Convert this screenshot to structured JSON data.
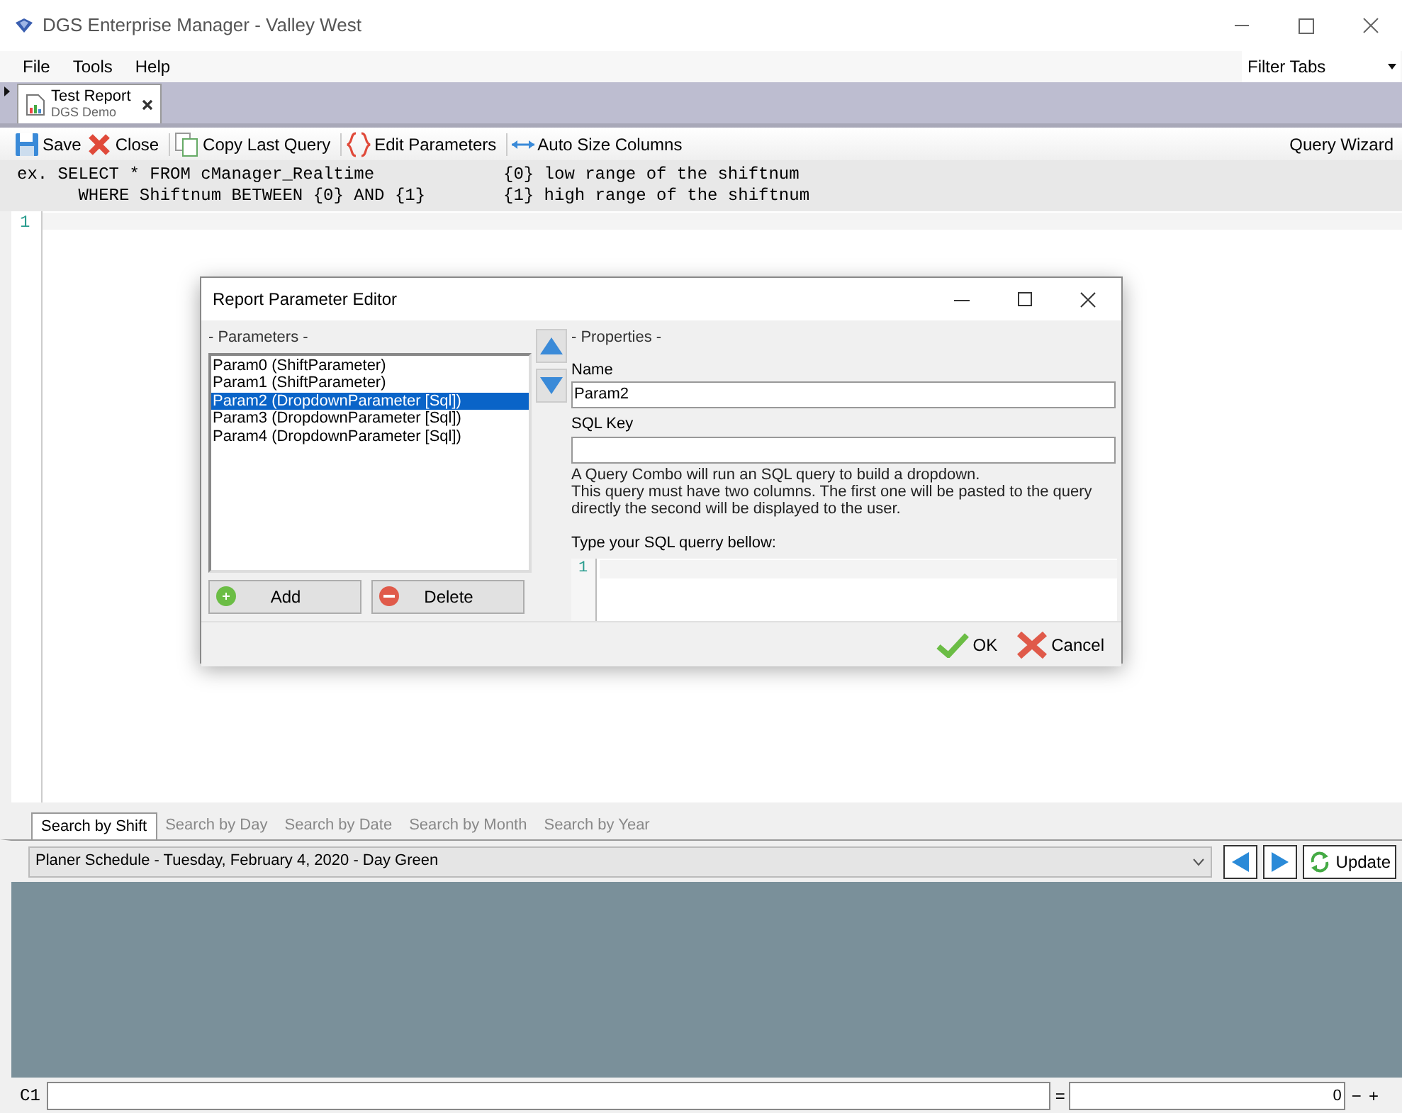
{
  "window": {
    "title": "DGS Enterprise Manager - Valley West"
  },
  "menu": [
    {
      "label": "File"
    },
    {
      "label": "Tools"
    },
    {
      "label": "Help"
    }
  ],
  "filter_tabs": {
    "value": "Filter Tabs"
  },
  "doc_tabs": [
    {
      "title": "Test Report",
      "subtitle": "DGS Demo",
      "selected": true
    }
  ],
  "toolbar": [
    {
      "kind": "save",
      "label": "Save"
    },
    {
      "kind": "close",
      "label": "Close"
    },
    {
      "kind": "copy",
      "label": "Copy Last Query"
    },
    {
      "kind": "params",
      "label": "Edit Parameters"
    },
    {
      "kind": "autosize",
      "label": "Auto Size Columns"
    }
  ],
  "query_wizard": "Query Wizard",
  "sql_hint": [
    {
      "code": "ex. SELECT * FROM cManager_Realtime",
      "note": "{0} low range of the shiftnum"
    },
    {
      "code": "      WHERE Shiftnum BETWEEN {0} AND {1}",
      "note": "{1} high range of the shiftnum"
    }
  ],
  "editor": {
    "line_numbers": [
      "1"
    ]
  },
  "dialog": {
    "title": "Report Parameter Editor",
    "parameters_label": "- Parameters -",
    "parameters": [
      {
        "label": "Param0 (ShiftParameter)",
        "selected": false
      },
      {
        "label": "Param1 (ShiftParameter)",
        "selected": false
      },
      {
        "label": "Param2 (DropdownParameter [Sql])",
        "selected": true
      },
      {
        "label": "Param3 (DropdownParameter [Sql])",
        "selected": false
      },
      {
        "label": "Param4 (DropdownParameter [Sql])",
        "selected": false
      }
    ],
    "add": "Add",
    "delete": "Delete",
    "properties_label": "- Properties -",
    "name_label": "Name",
    "name_value": "Param2",
    "sql_key_label": "SQL Key",
    "description": [
      "A Query Combo will run an SQL query to build a dropdown.",
      "This query must have two columns. The first one will be pasted to the query",
      "directly the second will be displayed to the user."
    ],
    "query_label": "Type your SQL querry bellow:",
    "query_line_numbers": [
      "1"
    ],
    "ok": "OK",
    "cancel": "Cancel"
  },
  "search_tabs": [
    {
      "label": "Search by Shift",
      "selected": true
    },
    {
      "label": "Search by Day",
      "selected": false
    },
    {
      "label": "Search by Date",
      "selected": false
    },
    {
      "label": "Search by Month",
      "selected": false
    },
    {
      "label": "Search by Year",
      "selected": false
    }
  ],
  "schedule": {
    "value": "Planer Schedule - Tuesday, February 4, 2020 - Day Green"
  },
  "update": "Update",
  "formula_bar": {
    "cell": "C1",
    "equals": "=",
    "result": "0",
    "minus": "−",
    "plus": "+"
  }
}
